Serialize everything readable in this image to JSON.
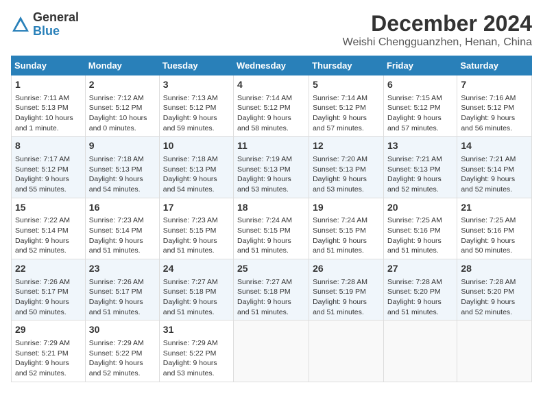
{
  "header": {
    "logo_general": "General",
    "logo_blue": "Blue",
    "title": "December 2024",
    "location": "Weishi Chengguanzhen, Henan, China"
  },
  "weekdays": [
    "Sunday",
    "Monday",
    "Tuesday",
    "Wednesday",
    "Thursday",
    "Friday",
    "Saturday"
  ],
  "weeks": [
    [
      {
        "day": "1",
        "info": "Sunrise: 7:11 AM\nSunset: 5:13 PM\nDaylight: 10 hours\nand 1 minute."
      },
      {
        "day": "2",
        "info": "Sunrise: 7:12 AM\nSunset: 5:12 PM\nDaylight: 10 hours\nand 0 minutes."
      },
      {
        "day": "3",
        "info": "Sunrise: 7:13 AM\nSunset: 5:12 PM\nDaylight: 9 hours\nand 59 minutes."
      },
      {
        "day": "4",
        "info": "Sunrise: 7:14 AM\nSunset: 5:12 PM\nDaylight: 9 hours\nand 58 minutes."
      },
      {
        "day": "5",
        "info": "Sunrise: 7:14 AM\nSunset: 5:12 PM\nDaylight: 9 hours\nand 57 minutes."
      },
      {
        "day": "6",
        "info": "Sunrise: 7:15 AM\nSunset: 5:12 PM\nDaylight: 9 hours\nand 57 minutes."
      },
      {
        "day": "7",
        "info": "Sunrise: 7:16 AM\nSunset: 5:12 PM\nDaylight: 9 hours\nand 56 minutes."
      }
    ],
    [
      {
        "day": "8",
        "info": "Sunrise: 7:17 AM\nSunset: 5:12 PM\nDaylight: 9 hours\nand 55 minutes."
      },
      {
        "day": "9",
        "info": "Sunrise: 7:18 AM\nSunset: 5:13 PM\nDaylight: 9 hours\nand 54 minutes."
      },
      {
        "day": "10",
        "info": "Sunrise: 7:18 AM\nSunset: 5:13 PM\nDaylight: 9 hours\nand 54 minutes."
      },
      {
        "day": "11",
        "info": "Sunrise: 7:19 AM\nSunset: 5:13 PM\nDaylight: 9 hours\nand 53 minutes."
      },
      {
        "day": "12",
        "info": "Sunrise: 7:20 AM\nSunset: 5:13 PM\nDaylight: 9 hours\nand 53 minutes."
      },
      {
        "day": "13",
        "info": "Sunrise: 7:21 AM\nSunset: 5:13 PM\nDaylight: 9 hours\nand 52 minutes."
      },
      {
        "day": "14",
        "info": "Sunrise: 7:21 AM\nSunset: 5:14 PM\nDaylight: 9 hours\nand 52 minutes."
      }
    ],
    [
      {
        "day": "15",
        "info": "Sunrise: 7:22 AM\nSunset: 5:14 PM\nDaylight: 9 hours\nand 52 minutes."
      },
      {
        "day": "16",
        "info": "Sunrise: 7:23 AM\nSunset: 5:14 PM\nDaylight: 9 hours\nand 51 minutes."
      },
      {
        "day": "17",
        "info": "Sunrise: 7:23 AM\nSunset: 5:15 PM\nDaylight: 9 hours\nand 51 minutes."
      },
      {
        "day": "18",
        "info": "Sunrise: 7:24 AM\nSunset: 5:15 PM\nDaylight: 9 hours\nand 51 minutes."
      },
      {
        "day": "19",
        "info": "Sunrise: 7:24 AM\nSunset: 5:15 PM\nDaylight: 9 hours\nand 51 minutes."
      },
      {
        "day": "20",
        "info": "Sunrise: 7:25 AM\nSunset: 5:16 PM\nDaylight: 9 hours\nand 51 minutes."
      },
      {
        "day": "21",
        "info": "Sunrise: 7:25 AM\nSunset: 5:16 PM\nDaylight: 9 hours\nand 50 minutes."
      }
    ],
    [
      {
        "day": "22",
        "info": "Sunrise: 7:26 AM\nSunset: 5:17 PM\nDaylight: 9 hours\nand 50 minutes."
      },
      {
        "day": "23",
        "info": "Sunrise: 7:26 AM\nSunset: 5:17 PM\nDaylight: 9 hours\nand 51 minutes."
      },
      {
        "day": "24",
        "info": "Sunrise: 7:27 AM\nSunset: 5:18 PM\nDaylight: 9 hours\nand 51 minutes."
      },
      {
        "day": "25",
        "info": "Sunrise: 7:27 AM\nSunset: 5:18 PM\nDaylight: 9 hours\nand 51 minutes."
      },
      {
        "day": "26",
        "info": "Sunrise: 7:28 AM\nSunset: 5:19 PM\nDaylight: 9 hours\nand 51 minutes."
      },
      {
        "day": "27",
        "info": "Sunrise: 7:28 AM\nSunset: 5:20 PM\nDaylight: 9 hours\nand 51 minutes."
      },
      {
        "day": "28",
        "info": "Sunrise: 7:28 AM\nSunset: 5:20 PM\nDaylight: 9 hours\nand 52 minutes."
      }
    ],
    [
      {
        "day": "29",
        "info": "Sunrise: 7:29 AM\nSunset: 5:21 PM\nDaylight: 9 hours\nand 52 minutes."
      },
      {
        "day": "30",
        "info": "Sunrise: 7:29 AM\nSunset: 5:22 PM\nDaylight: 9 hours\nand 52 minutes."
      },
      {
        "day": "31",
        "info": "Sunrise: 7:29 AM\nSunset: 5:22 PM\nDaylight: 9 hours\nand 53 minutes."
      },
      null,
      null,
      null,
      null
    ]
  ]
}
